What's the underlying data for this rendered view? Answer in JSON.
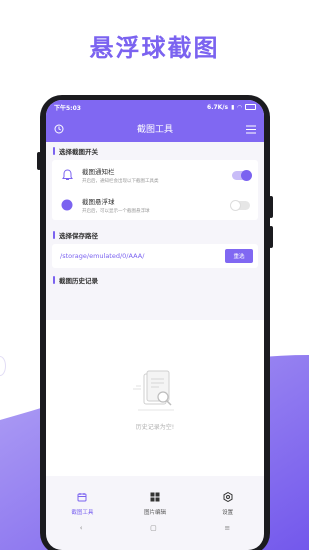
{
  "promo": {
    "title": "悬浮球截图"
  },
  "status": {
    "time": "下午5:03",
    "speed": "6.7K/s",
    "battery": ""
  },
  "appbar": {
    "title": "截图工具",
    "history_icon": "clock-icon",
    "menu_icon": "list-icon"
  },
  "section_toggle": {
    "title": "选择截图开关"
  },
  "settings": [
    {
      "title": "截图通知栏",
      "desc": "开启后，通知栏会出现以下截图工具类",
      "enabled": true,
      "icon": "bell-icon"
    },
    {
      "title": "截图悬浮球",
      "desc": "开启后，可以显示一个截图悬浮球",
      "enabled": false,
      "icon": "dot-icon"
    }
  ],
  "section_path": {
    "title": "选择保存路径"
  },
  "path": {
    "value": "/storage/emulated/0/AAA/",
    "button": "重选"
  },
  "section_history": {
    "title": "截图历史记录"
  },
  "empty": {
    "text": "历史记录为空!"
  },
  "tabs": [
    {
      "label": "截图工具",
      "icon": "calendar-icon",
      "active": true
    },
    {
      "label": "图片编辑",
      "icon": "grid-icon",
      "active": false
    },
    {
      "label": "设置",
      "icon": "settings-icon",
      "active": false
    }
  ],
  "nav": {
    "back": "‹",
    "home": "▢",
    "recents": "≡"
  },
  "colors": {
    "accent": "#7b63f0",
    "header": "#8068f2"
  }
}
